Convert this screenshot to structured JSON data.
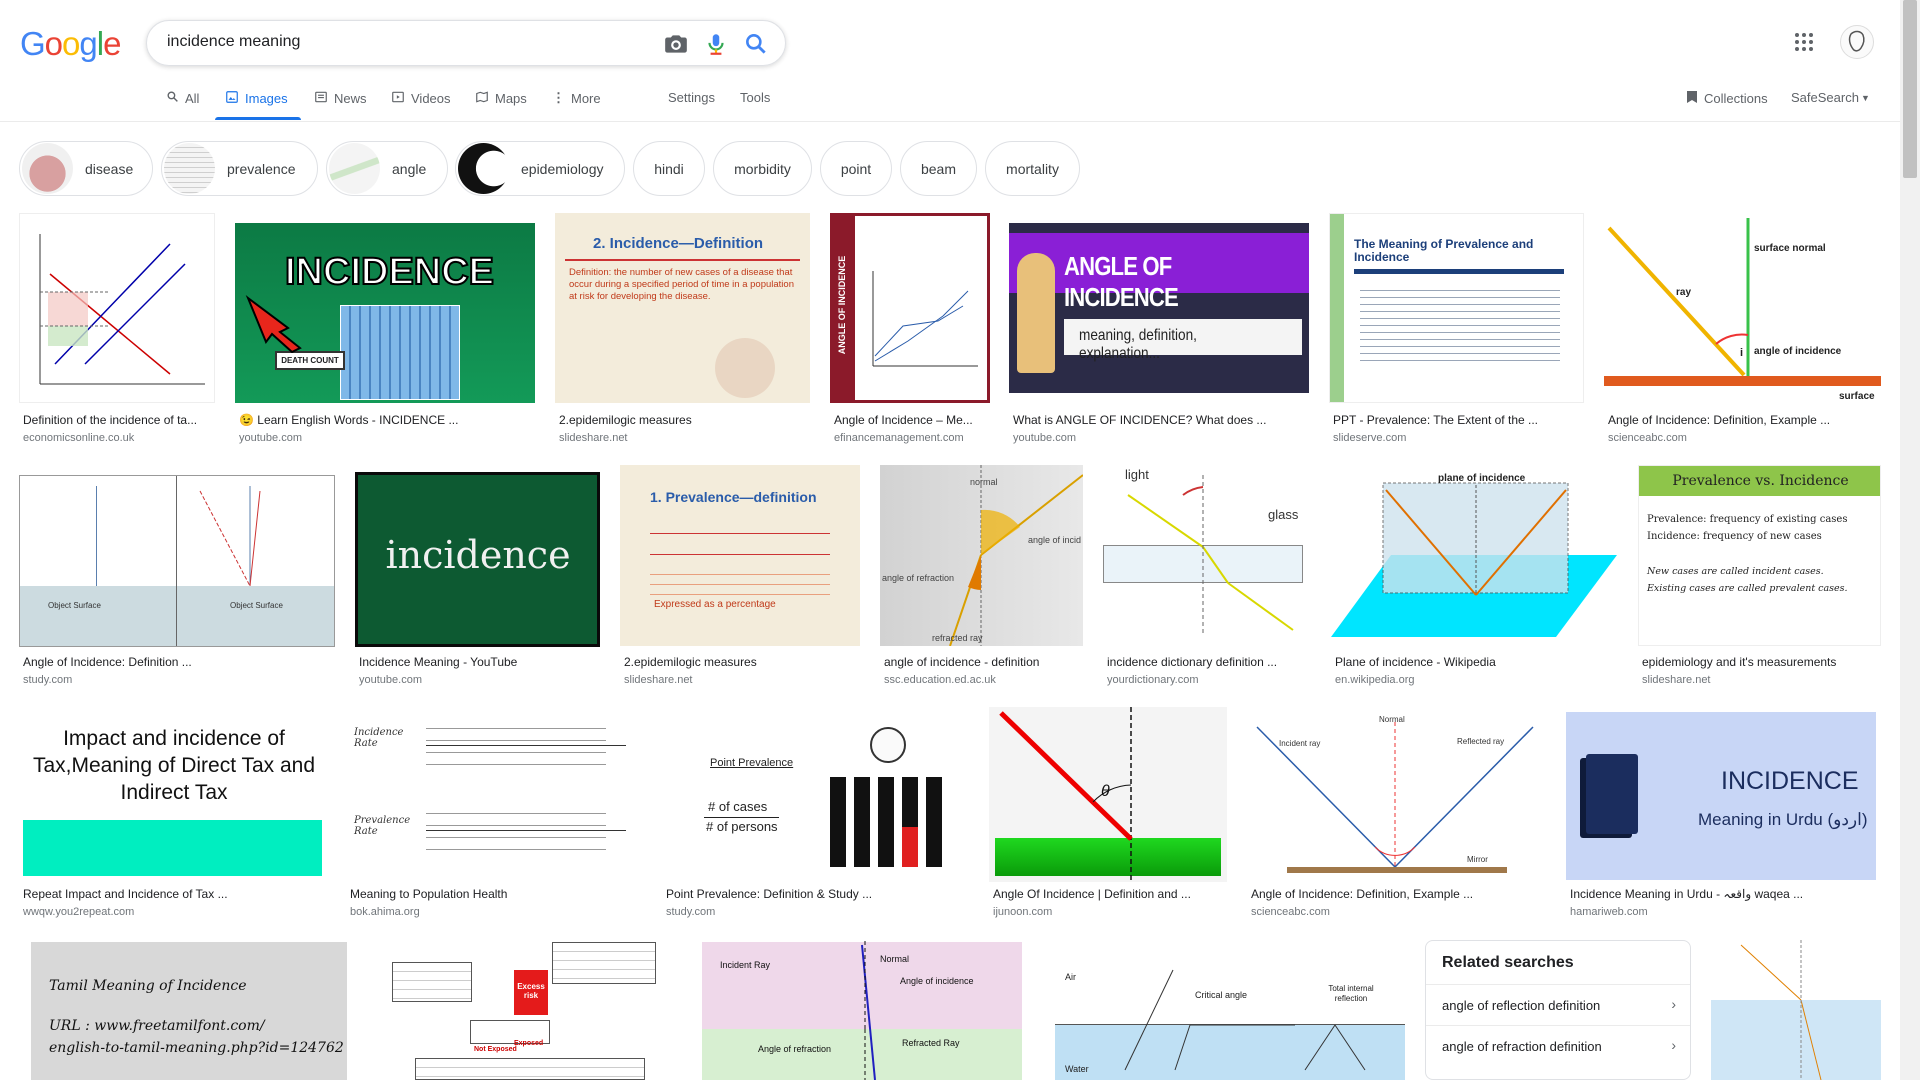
{
  "search": {
    "query": "incidence meaning"
  },
  "logo": {
    "letters": [
      "G",
      "o",
      "o",
      "g",
      "l",
      "e"
    ],
    "colors": [
      "#4285f4",
      "#ea4335",
      "#fbbc05",
      "#4285f4",
      "#34a853",
      "#ea4335"
    ]
  },
  "nav": {
    "tabs": [
      {
        "label": "All",
        "icon": "search-icon"
      },
      {
        "label": "Images",
        "icon": "image-icon"
      },
      {
        "label": "News",
        "icon": "news-icon"
      },
      {
        "label": "Videos",
        "icon": "video-icon"
      },
      {
        "label": "Maps",
        "icon": "map-icon"
      },
      {
        "label": "More",
        "icon": "more-vert-icon"
      }
    ],
    "settings": "Settings",
    "tools": "Tools",
    "collections": "Collections",
    "safesearch": "SafeSearch"
  },
  "chips": [
    "disease",
    "prevalence",
    "angle",
    "epidemiology",
    "hindi",
    "morbidity",
    "point",
    "beam",
    "mortality"
  ],
  "results": [
    {
      "caption": "Definition of the incidence of ta...",
      "source": "economicsonline.co.uk",
      "bg": "#ffffff"
    },
    {
      "caption": "😉 Learn English Words - INCIDENCE ...",
      "source": "youtube.com",
      "bg": "#1f8a4c",
      "title": "INCIDENCE",
      "label": "DEATH COUNT"
    },
    {
      "caption": "2.epidemilogic measures",
      "source": "slideshare.net",
      "bg": "#f1ebdc",
      "title": "2. Incidence—Definition",
      "label": "Definition: the number of new cases of a disease that occur during a specified period of time in a population at risk for developing the disease."
    },
    {
      "caption": "Angle of Incidence – Me...",
      "source": "efinancemanagement.com",
      "bg": "#ffffff",
      "title": "ANGLE OF INCIDENCE"
    },
    {
      "caption": "What is ANGLE OF INCIDENCE? What does ...",
      "source": "youtube.com",
      "bg": "#2a2a4a",
      "title": "ANGLE OF INCIDENCE",
      "label": "meaning, definition, explanation..."
    },
    {
      "caption": "PPT - Prevalence: The Extent of the ...",
      "source": "slideserve.com",
      "bg": "#ffffff",
      "title": "The Meaning of Prevalence and Incidence"
    },
    {
      "caption": "Angle of Incidence: Definition, Example ...",
      "source": "scienceabc.com",
      "bg": "#ffffff",
      "labels": [
        "surface normal",
        "ray",
        "angle of incidence",
        "surface",
        "i"
      ]
    },
    {
      "caption": "Angle of Incidence: Definition ...",
      "source": "study.com",
      "bg": "#ffffff",
      "labels": [
        "Object Surface",
        "Object Surface"
      ]
    },
    {
      "caption": "Incidence Meaning - YouTube",
      "source": "youtube.com",
      "bg": "#1e5a3a",
      "title": "incidence"
    },
    {
      "caption": "2.epidemilogic measures",
      "source": "slideshare.net",
      "bg": "#f1ebdc",
      "title": "1. Prevalence—definition",
      "label": "Expressed as a percentage"
    },
    {
      "caption": "angle of incidence - definition",
      "source": "ssc.education.ed.ac.uk",
      "bg": "#dcdcdc",
      "labels": [
        "normal",
        "angle of incid",
        "angle of refraction",
        "refracted ray"
      ]
    },
    {
      "caption": "incidence dictionary definition ...",
      "source": "yourdictionary.com",
      "bg": "#ffffff",
      "labels": [
        "light",
        "glass"
      ]
    },
    {
      "caption": "Plane of incidence - Wikipedia",
      "source": "en.wikipedia.org",
      "bg": "#ffffff",
      "title": "plane of incidence"
    },
    {
      "caption": "epidemiology and it's measurements",
      "source": "slideshare.net",
      "bg": "#ffffff",
      "title": "Prevalence  vs. Incidence",
      "lines": [
        "Prevalence: frequency of existing cases",
        "Incidence: frequency of new cases",
        "New cases are called incident cases.",
        "Existing cases are called prevalent cases."
      ]
    },
    {
      "caption": "Repeat Impact and Incidence of Tax ...",
      "source": "wwqw.you2repeat.com",
      "bg": "#ffffff",
      "title": "Impact and incidence of Tax,Meaning of Direct Tax and Indirect Tax"
    },
    {
      "caption": "Meaning to Population Health",
      "source": "bok.ahima.org",
      "bg": "#ffffff",
      "labels": [
        "Incidence Rate",
        "Prevalence Rate"
      ]
    },
    {
      "caption": "Point Prevalence: Definition & Study ...",
      "source": "study.com",
      "bg": "#ffffff",
      "labels": [
        "Point Prevalence",
        "# of cases",
        "# of persons"
      ]
    },
    {
      "caption": "Angle Of Incidence | Definition and ...",
      "source": "ijunoon.com",
      "bg": "#f5f5f5",
      "labels": [
        "θ"
      ]
    },
    {
      "caption": "Angle of Incidence: Definition, Example ...",
      "source": "scienceabc.com",
      "bg": "#ffffff",
      "labels": [
        "Normal",
        "Incident ray",
        "Reflected ray",
        "Mirror"
      ]
    },
    {
      "caption": "Incidence Meaning in Urdu - واقعہ waqea ...",
      "source": "hamariweb.com",
      "bg": "#c4d4f4",
      "title": "INCIDENCE",
      "label": "Meaning in Urdu (اردو)"
    },
    {
      "caption": "",
      "source": "",
      "bg": "#d9d9d9",
      "lines": [
        "Tamil Meaning of Incidence",
        "URL : www.freetamilfont.com/",
        "english-to-tamil-meaning.php?id=124762"
      ]
    },
    {
      "caption": "",
      "source": "",
      "bg": "#ffffff",
      "labels": [
        "Excess risk",
        "Not Exposed",
        "Exposed"
      ]
    },
    {
      "caption": "",
      "source": "",
      "bg": "#efd8ea",
      "labels": [
        "Incident Ray",
        "Normal",
        "Angle of incidence",
        "Angle of refraction",
        "Refracted Ray"
      ]
    },
    {
      "caption": "",
      "source": "",
      "bg": "#ffffff",
      "labels": [
        "Air",
        "Water",
        "Critical angle",
        "Total internal reflection"
      ]
    },
    {
      "caption": "",
      "source": "",
      "bg": "#ffffff"
    }
  ],
  "related": {
    "title": "Related searches",
    "items": [
      "angle of reflection definition",
      "angle of refraction definition"
    ]
  }
}
